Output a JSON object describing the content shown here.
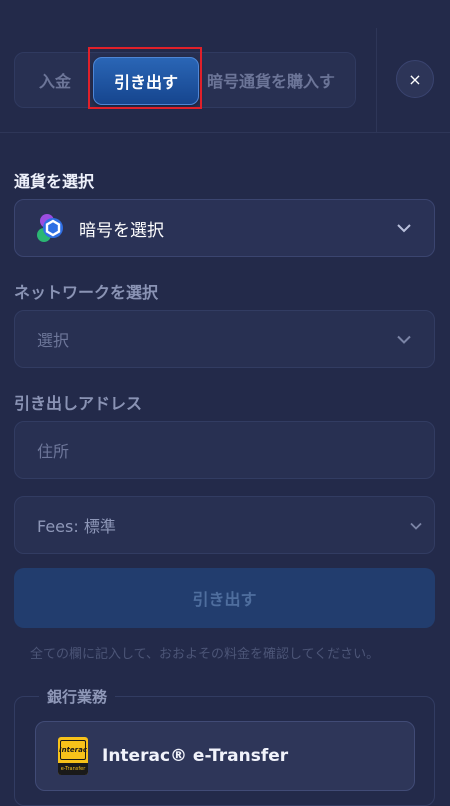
{
  "tabs": {
    "deposit": "入金",
    "withdraw": "引き出す",
    "buy_crypto": "暗号通貨を購入す"
  },
  "close_icon": "×",
  "currency": {
    "label": "通貨を選択",
    "value": "暗号を選択",
    "icon": "crypto-coin-icon"
  },
  "network": {
    "label": "ネットワークを選択",
    "placeholder": "選択"
  },
  "address": {
    "label": "引き出しアドレス",
    "placeholder": "住所"
  },
  "fees": {
    "value": "Fees: 標準"
  },
  "submit_label": "引き出す",
  "hint": "全ての欄に記入して、おおよその料金を確認してください。",
  "bank": {
    "legend": "銀行業務",
    "items": [
      {
        "label": "Interac® e-Transfer",
        "logo_text": "Interac",
        "logo_sub": "e-Transfer"
      }
    ]
  },
  "colors": {
    "background": "#232a4a",
    "active_tab": "#1f57a6",
    "highlight": "#e0202a"
  }
}
